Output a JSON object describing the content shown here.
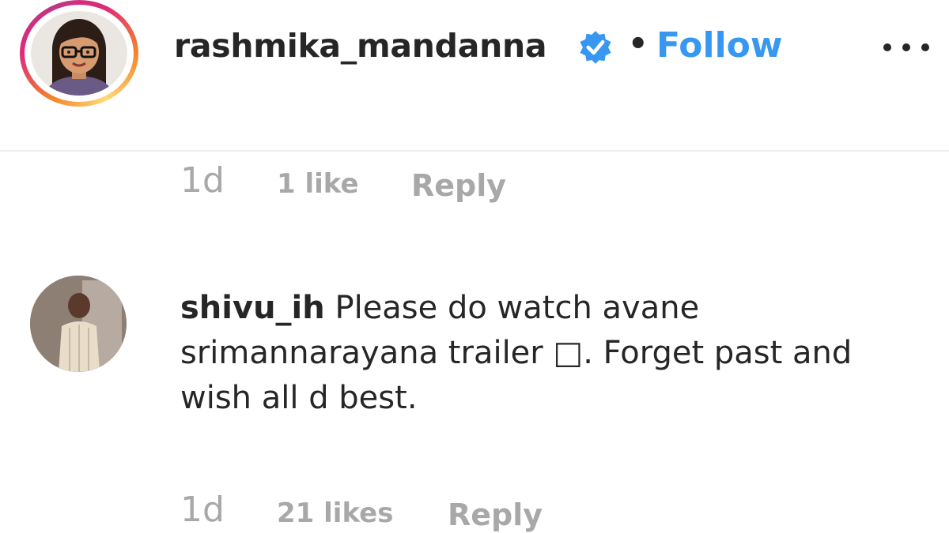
{
  "post_header": {
    "username": "rashmika_mandanna",
    "verified_icon": "verified-badge-icon",
    "separator": "•",
    "follow_label": "Follow",
    "more_icon": "more-options-icon",
    "accent_color": "#3897f0"
  },
  "caption_meta": {
    "time": "1d",
    "likes": "1 like",
    "reply_label": "Reply"
  },
  "comments": [
    {
      "username": "shivu_ih",
      "text": "Please do watch avane srimannarayana trailer □. Forget past and wish all d best.",
      "time": "1d",
      "likes": "21 likes",
      "reply_label": "Reply"
    }
  ]
}
